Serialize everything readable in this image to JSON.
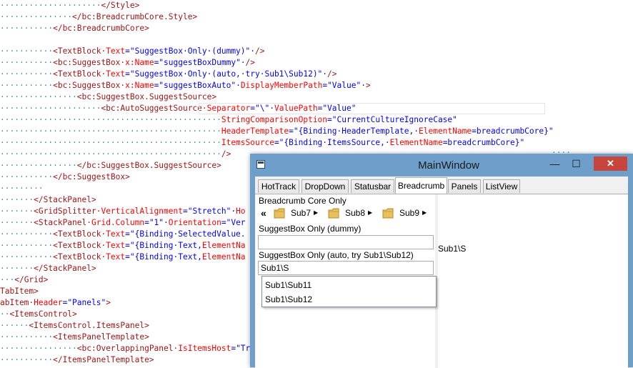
{
  "editor": {
    "lines": [
      {
        "indent": "·····················",
        "parts": [
          {
            "t": "tg",
            "v": "</Style>"
          }
        ]
      },
      {
        "indent": "···············",
        "parts": [
          {
            "t": "tg",
            "v": "</bc:BreadcrumbCore.Style>"
          }
        ]
      },
      {
        "indent": "···········",
        "parts": [
          {
            "t": "tg",
            "v": "</bc:BreadcrumbCore>"
          }
        ]
      },
      {
        "indent": "",
        "parts": []
      },
      {
        "indent": "···········",
        "parts": [
          {
            "t": "tg",
            "v": "<TextBlock·"
          },
          {
            "t": "at",
            "v": "Text"
          },
          {
            "t": "vl",
            "v": "=\"SuggestBox·Only·(dummy)\"·"
          },
          {
            "t": "tg",
            "v": "/>"
          }
        ]
      },
      {
        "indent": "···········",
        "parts": [
          {
            "t": "tg",
            "v": "<bc:SuggestBox·"
          },
          {
            "t": "at",
            "v": "x:Name"
          },
          {
            "t": "vl",
            "v": "=\"suggestBoxDummy\"·"
          },
          {
            "t": "tg",
            "v": "/>"
          }
        ]
      },
      {
        "indent": "···········",
        "parts": [
          {
            "t": "tg",
            "v": "<TextBlock·"
          },
          {
            "t": "at",
            "v": "Text"
          },
          {
            "t": "vl",
            "v": "=\"SuggestBox·Only·(auto,·try·Sub1\\Sub12)\"·"
          },
          {
            "t": "tg",
            "v": "/>"
          }
        ]
      },
      {
        "indent": "···········",
        "parts": [
          {
            "t": "tg",
            "v": "<bc:SuggestBox·"
          },
          {
            "t": "at",
            "v": "x:Name"
          },
          {
            "t": "vl",
            "v": "=\"suggestBoxAuto\"·"
          },
          {
            "t": "at",
            "v": "DisplayMemberPath"
          },
          {
            "t": "vl",
            "v": "=\"Value\"·"
          },
          {
            "t": "tg",
            "v": ">"
          }
        ]
      },
      {
        "indent": "················",
        "parts": [
          {
            "t": "tg",
            "v": "<bc:SuggestBox.SuggestSource>"
          }
        ]
      },
      {
        "indent": "·····················",
        "parts": [
          {
            "t": "tg",
            "v": "<bc:AutoSuggestSource·"
          },
          {
            "t": "at",
            "v": "Separator"
          },
          {
            "t": "vl",
            "v": "=\"\\\"·"
          },
          {
            "t": "at",
            "v": "ValuePath"
          },
          {
            "t": "vl",
            "v": "=\"Value\""
          }
        ]
      },
      {
        "indent": "··············································",
        "parts": [
          {
            "t": "at",
            "v": "StringComparisonOption"
          },
          {
            "t": "vl",
            "v": "=\"CurrentCultureIgnoreCase\""
          }
        ]
      },
      {
        "indent": "··············································",
        "parts": [
          {
            "t": "at",
            "v": "HeaderTemplate"
          },
          {
            "t": "vl",
            "v": "=\"{Binding·HeaderTemplate,·"
          },
          {
            "t": "at",
            "v": "ElementName"
          },
          {
            "t": "vl",
            "v": "=breadcrumbCore}\""
          }
        ]
      },
      {
        "indent": "··············································",
        "parts": [
          {
            "t": "at",
            "v": "ItemsSource"
          },
          {
            "t": "vl",
            "v": "=\"{Binding·ItemsSource,·"
          },
          {
            "t": "at",
            "v": "ElementName"
          },
          {
            "t": "vl",
            "v": "=breadcrumbCore}\""
          }
        ]
      },
      {
        "indent": "··············································",
        "parts": [
          {
            "t": "tg",
            "v": "/>"
          }
        ]
      },
      {
        "indent": "················",
        "parts": [
          {
            "t": "tg",
            "v": "</bc:SuggestBox.SuggestSource>"
          }
        ]
      },
      {
        "indent": "···········",
        "parts": [
          {
            "t": "tg",
            "v": "</bc:SuggestBox>"
          }
        ]
      },
      {
        "indent": "·········",
        "parts": []
      },
      {
        "indent": "·······",
        "parts": [
          {
            "t": "tg",
            "v": "</StackPanel>"
          }
        ]
      },
      {
        "indent": "·······",
        "parts": [
          {
            "t": "tg",
            "v": "<GridSplitter·"
          },
          {
            "t": "at",
            "v": "VerticalAlignment"
          },
          {
            "t": "vl",
            "v": "=\"Stretch\"·"
          },
          {
            "t": "at",
            "v": "Ho"
          }
        ]
      },
      {
        "indent": "·······",
        "parts": [
          {
            "t": "tg",
            "v": "<StackPanel·"
          },
          {
            "t": "at",
            "v": "Grid.Column"
          },
          {
            "t": "vl",
            "v": "=\"1\"·"
          },
          {
            "t": "at",
            "v": "Orientation"
          },
          {
            "t": "vl",
            "v": "=\"Ver"
          }
        ]
      },
      {
        "indent": "···········",
        "parts": [
          {
            "t": "tg",
            "v": "<TextBlock·"
          },
          {
            "t": "at",
            "v": "Text"
          },
          {
            "t": "vl",
            "v": "=\"{Binding·SelectedValue."
          }
        ]
      },
      {
        "indent": "···········",
        "parts": [
          {
            "t": "tg",
            "v": "<TextBlock·"
          },
          {
            "t": "at",
            "v": "Text"
          },
          {
            "t": "vl",
            "v": "=\"{Binding·Text,"
          },
          {
            "t": "at",
            "v": "ElementNa"
          }
        ]
      },
      {
        "indent": "···········",
        "parts": [
          {
            "t": "tg",
            "v": "<TextBlock·"
          },
          {
            "t": "at",
            "v": "Text"
          },
          {
            "t": "vl",
            "v": "=\"{Binding·Text,"
          },
          {
            "t": "at",
            "v": "ElementNa"
          }
        ]
      },
      {
        "indent": "·······",
        "parts": [
          {
            "t": "tg",
            "v": "</StackPanel>"
          }
        ]
      },
      {
        "indent": "···",
        "parts": [
          {
            "t": "tg",
            "v": "</Grid>"
          }
        ]
      },
      {
        "indent": "",
        "parts": [
          {
            "t": "tg",
            "v": "TabItem>"
          }
        ]
      },
      {
        "indent": "",
        "parts": [
          {
            "t": "tg",
            "v": "abItem·"
          },
          {
            "t": "at",
            "v": "Header"
          },
          {
            "t": "vl",
            "v": "=\"Panels\""
          },
          {
            "t": "tg",
            "v": ">"
          }
        ]
      },
      {
        "indent": "··",
        "parts": [
          {
            "t": "tg",
            "v": "<ItemsControl>"
          }
        ]
      },
      {
        "indent": "······",
        "parts": [
          {
            "t": "tg",
            "v": "<ItemsControl.ItemsPanel>"
          }
        ]
      },
      {
        "indent": "···········",
        "parts": [
          {
            "t": "tg",
            "v": "<ItemsPanelTemplate>"
          }
        ]
      },
      {
        "indent": "················",
        "parts": [
          {
            "t": "tg",
            "v": "<bc:OverlappingPanel·"
          },
          {
            "t": "at",
            "v": "IsItemsHost"
          },
          {
            "t": "vl",
            "v": "=\"Tr"
          }
        ]
      },
      {
        "indent": "···········",
        "parts": [
          {
            "t": "tg",
            "v": "</ItemsPanelTemplate>"
          }
        ]
      }
    ],
    "right_glyphs": [
      "····"
    ]
  },
  "window": {
    "title": "MainWindow",
    "minimize": "—",
    "maximize": "☐",
    "close": "✕",
    "tabs": [
      {
        "label": "HotTrack"
      },
      {
        "label": "DropDown"
      },
      {
        "label": "Statusbar"
      },
      {
        "label": "Breadcrumb"
      },
      {
        "label": "Panels"
      },
      {
        "label": "ListView"
      }
    ],
    "active_tab": "Breadcrumb",
    "content": {
      "breadcrumb_label": "Breadcrumb Core Only",
      "breadcrumb": {
        "overflow": "«",
        "items": [
          {
            "label": "Sub7"
          },
          {
            "label": "Sub8"
          },
          {
            "label": "Sub9"
          }
        ],
        "arrow": "▶"
      },
      "dummy_label": "SuggestBox Only (dummy)",
      "dummy_value": "",
      "auto_label": "SuggestBox Only (auto, try Sub1\\Sub12)",
      "auto_value": "Sub1\\S",
      "suggestions": [
        "Sub1\\Sub11",
        "Sub1\\Sub12"
      ],
      "right_text": "Sub1\\S"
    },
    "colors": {
      "titlebar": "#6e9fca",
      "close": "#c7453c"
    }
  }
}
